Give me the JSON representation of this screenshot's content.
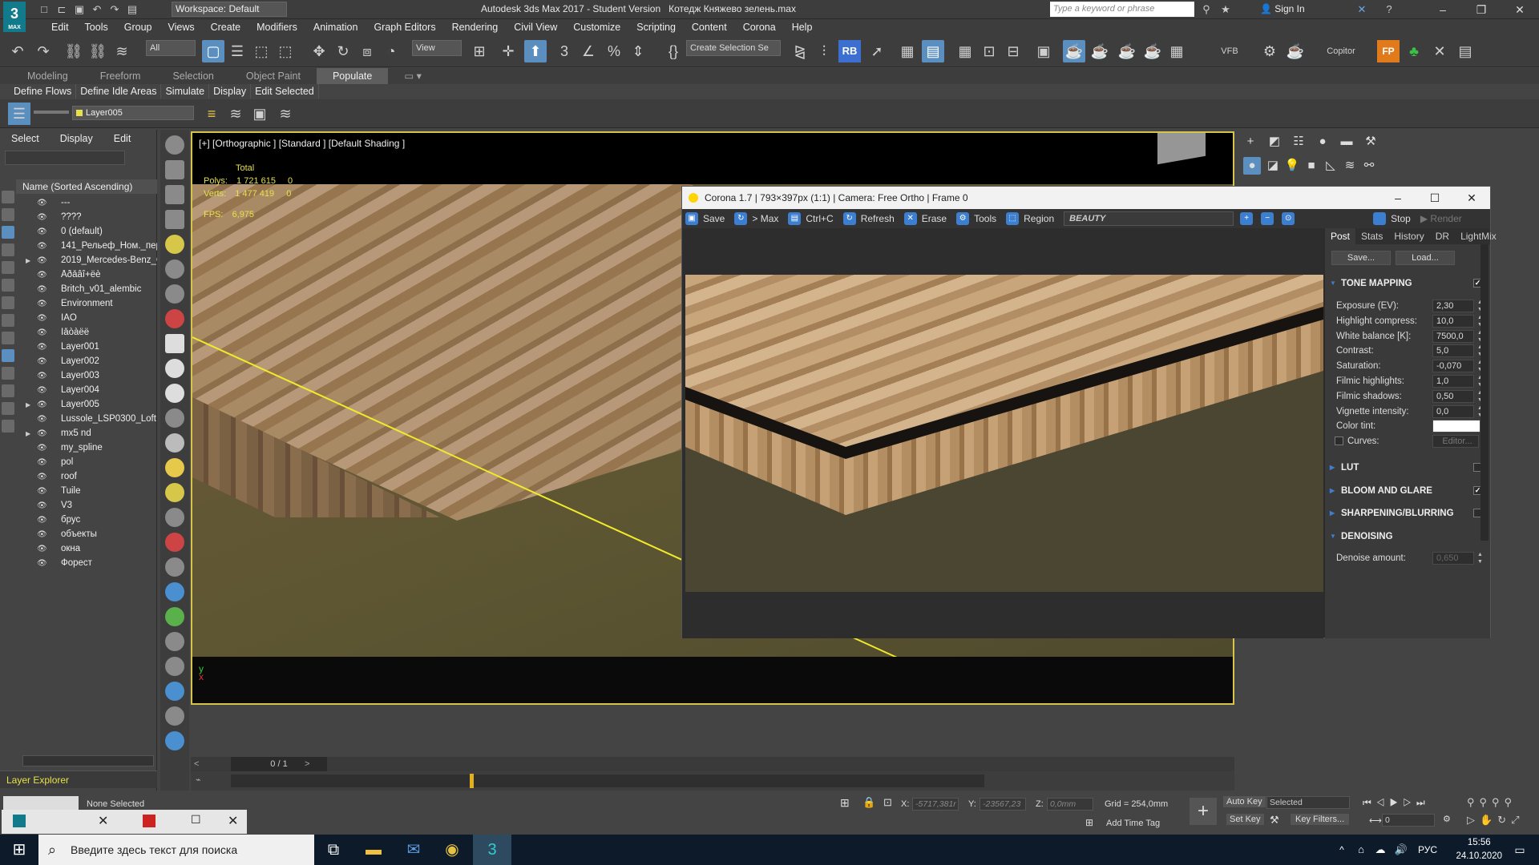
{
  "app": {
    "title": "Autodesk 3ds Max 2017 - Student Version",
    "file": "Котедж Княжево зелень.max",
    "logo": "3",
    "logo_sub": "MAX",
    "workspace": "Workspace: Default",
    "keyword_placeholder": "Type a keyword or phrase",
    "sign_in": "Sign In"
  },
  "menu": [
    "Edit",
    "Tools",
    "Group",
    "Views",
    "Create",
    "Modifiers",
    "Animation",
    "Graph Editors",
    "Rendering",
    "Civil View",
    "Customize",
    "Scripting",
    "Content",
    "Corona",
    "Help"
  ],
  "toolbar": {
    "filter": "All",
    "view": "View",
    "selection_set": "Create Selection Se",
    "rb": "RB",
    "vfb": "VFB",
    "copitor": "Copitor",
    "fp": "FP"
  },
  "ribbon_tabs": [
    "Modeling",
    "Freeform",
    "Selection",
    "Object Paint",
    "Populate"
  ],
  "ribbon_active": "Populate",
  "ribbon_buttons": [
    "Define Flows",
    "Define Idle Areas",
    "Simulate",
    "Display",
    "Edit Selected"
  ],
  "layer_current": "Layer005",
  "explorer": {
    "tabs": [
      "Select",
      "Display",
      "Edit"
    ],
    "column": "Name (Sorted Ascending)",
    "footer": "Layer Explorer",
    "layers": [
      "---",
      "????",
      "0 (default)",
      "141_Рельеф_Ном._пер",
      "2019_Mercedes-Benz_G",
      "Åðåâî+ëè",
      "Britch_v01_alembic",
      "Environment",
      "ÌÄÖ",
      "Ìåòàëë",
      "Layer001",
      "Layer002",
      "Layer003",
      "Layer004",
      "Layer005",
      "Lussole_LSP0300_Loft",
      "mx5 nd",
      "my_spline",
      "pol",
      "roof",
      "Tuile",
      "V3",
      "брус",
      "объекты",
      "окна",
      "Форест"
    ]
  },
  "viewport": {
    "label": "[+] [Orthographic ] [Standard ] [Default Shading ]",
    "total": "Total",
    "polys_label": "Polys:",
    "polys": "1 721 615",
    "polys_sel": "0",
    "verts_label": "Verts:",
    "verts": "1 477 419",
    "verts_sel": "0",
    "fps_label": "FPS:",
    "fps": "6,975",
    "frame": "0 / 1"
  },
  "corona": {
    "title": "Corona 1.7 | 793×397px (1:1) | Camera: Free Ortho | Frame 0",
    "toolbar": [
      "Save",
      "> Max",
      "Ctrl+C",
      "Refresh",
      "Erase",
      "Tools",
      "Region"
    ],
    "channel": "BEAUTY",
    "stop": "Stop",
    "render": "Render",
    "tabs": [
      "Post",
      "Stats",
      "History",
      "DR",
      "LightMix"
    ],
    "save_btn": "Save...",
    "load_btn": "Load...",
    "tone_mapping": "TONE MAPPING",
    "params": [
      {
        "label": "Exposure (EV):",
        "value": "2,30"
      },
      {
        "label": "Highlight compress:",
        "value": "10,0"
      },
      {
        "label": "White balance [K]:",
        "value": "7500,0"
      },
      {
        "label": "Contrast:",
        "value": "5,0"
      },
      {
        "label": "Saturation:",
        "value": "-0,070"
      },
      {
        "label": "Filmic highlights:",
        "value": "1,0"
      },
      {
        "label": "Filmic shadows:",
        "value": "0,50"
      },
      {
        "label": "Vignette intensity:",
        "value": "0,0"
      }
    ],
    "color_tint": "Color tint:",
    "curves": "Curves:",
    "editor": "Editor...",
    "lut": "LUT",
    "bloom": "BLOOM AND GLARE",
    "sharpen": "SHARPENING/BLURRING",
    "denoise": "DENOISING",
    "denoise_amount": "Denoise amount:",
    "denoise_value": "0,650"
  },
  "status": {
    "none_selected": "None Selected",
    "x_label": "X:",
    "x": "-5717,381r",
    "y_label": "Y:",
    "y": "-23567,23",
    "z_label": "Z:",
    "z": "0,0mm",
    "grid": "Grid = 254,0mm",
    "add_time_tag": "Add Time Tag",
    "auto_key": "Auto Key",
    "set_key": "Set Key",
    "selected": "Selected",
    "key_filters": "Key Filters...",
    "frame_num": "0"
  },
  "taskbar": {
    "search": "Введите здесь текст для поиска",
    "lang": "РУС",
    "time": "15:56",
    "date": "24.10.2020"
  }
}
